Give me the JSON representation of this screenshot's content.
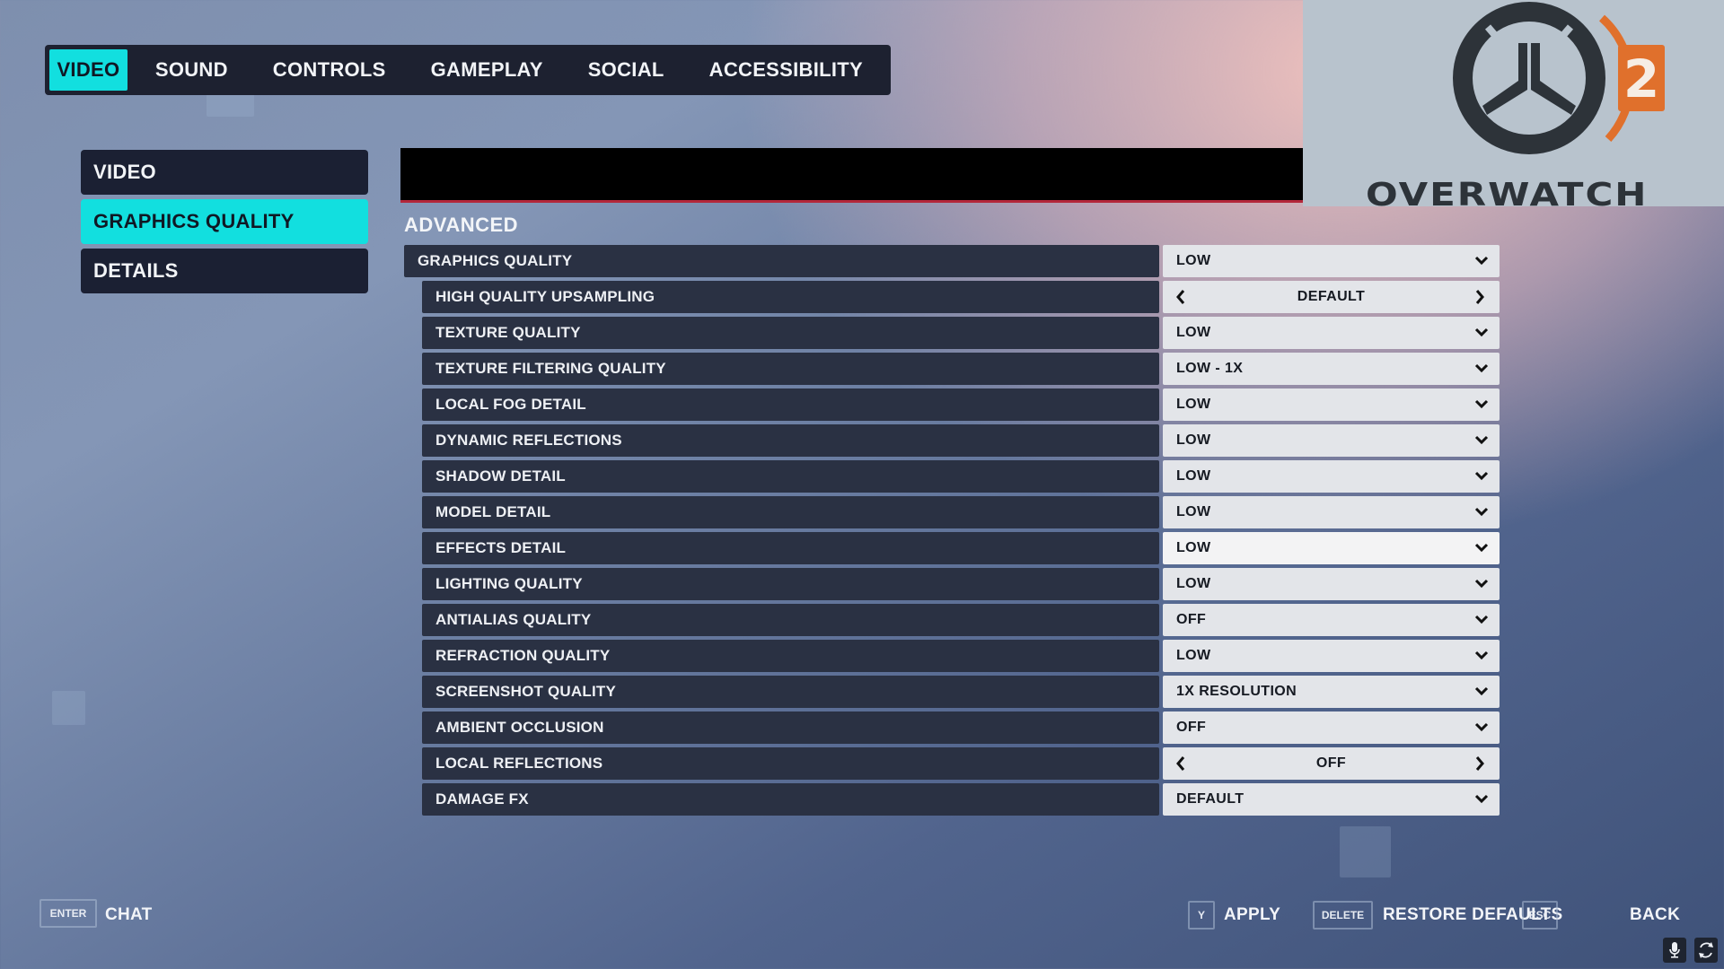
{
  "top_tabs": [
    {
      "label": "VIDEO",
      "active": true
    },
    {
      "label": "SOUND",
      "active": false
    },
    {
      "label": "CONTROLS",
      "active": false
    },
    {
      "label": "GAMEPLAY",
      "active": false
    },
    {
      "label": "SOCIAL",
      "active": false
    },
    {
      "label": "ACCESSIBILITY",
      "active": false
    }
  ],
  "logo": {
    "wordmark": "OVERWATCH",
    "number": "2",
    "accent": "#e0702c",
    "dark": "#2d3339"
  },
  "sub_nav": [
    {
      "label": "VIDEO",
      "active": false
    },
    {
      "label": "GRAPHICS QUALITY",
      "active": true
    },
    {
      "label": "DETAILS",
      "active": false
    }
  ],
  "section_title": "ADVANCED",
  "settings": [
    {
      "label": "GRAPHICS QUALITY",
      "value": "LOW",
      "control": "dropdown",
      "indent": false
    },
    {
      "label": "HIGH QUALITY UPSAMPLING",
      "value": "DEFAULT",
      "control": "stepper",
      "indent": true
    },
    {
      "label": "TEXTURE QUALITY",
      "value": "LOW",
      "control": "dropdown",
      "indent": true
    },
    {
      "label": "TEXTURE FILTERING QUALITY",
      "value": "LOW - 1X",
      "control": "dropdown",
      "indent": true
    },
    {
      "label": "LOCAL FOG DETAIL",
      "value": "LOW",
      "control": "dropdown",
      "indent": true
    },
    {
      "label": "DYNAMIC REFLECTIONS",
      "value": "LOW",
      "control": "dropdown",
      "indent": true
    },
    {
      "label": "SHADOW DETAIL",
      "value": "LOW",
      "control": "dropdown",
      "indent": true
    },
    {
      "label": "MODEL DETAIL",
      "value": "LOW",
      "control": "dropdown",
      "indent": true
    },
    {
      "label": "EFFECTS DETAIL",
      "value": "LOW",
      "control": "dropdown",
      "indent": true,
      "hover": true
    },
    {
      "label": "LIGHTING QUALITY",
      "value": "LOW",
      "control": "dropdown",
      "indent": true
    },
    {
      "label": "ANTIALIAS QUALITY",
      "value": "OFF",
      "control": "dropdown",
      "indent": true
    },
    {
      "label": "REFRACTION QUALITY",
      "value": "LOW",
      "control": "dropdown",
      "indent": true
    },
    {
      "label": "SCREENSHOT QUALITY",
      "value": "1X RESOLUTION",
      "control": "dropdown",
      "indent": true
    },
    {
      "label": "AMBIENT OCCLUSION",
      "value": "OFF",
      "control": "dropdown",
      "indent": true
    },
    {
      "label": "LOCAL REFLECTIONS",
      "value": "OFF",
      "control": "stepper",
      "indent": true
    },
    {
      "label": "DAMAGE FX",
      "value": "DEFAULT",
      "control": "dropdown",
      "indent": true
    }
  ],
  "footer": {
    "chat": {
      "key": "ENTER",
      "label": "CHAT"
    },
    "apply": {
      "key": "Y",
      "label": "APPLY"
    },
    "restore": {
      "key": "DELETE",
      "label": "RESTORE DEFAULTS"
    },
    "back": {
      "key": "ESC",
      "label": "BACK"
    },
    "icons": [
      "microphone-icon",
      "refresh-icon"
    ]
  },
  "colors": {
    "accent": "#12dfdf",
    "panel_dark": "#1d2130",
    "row_dark": "#2a3143",
    "value_bg": "#e3e5e9",
    "underline_red": "#b3273a"
  }
}
